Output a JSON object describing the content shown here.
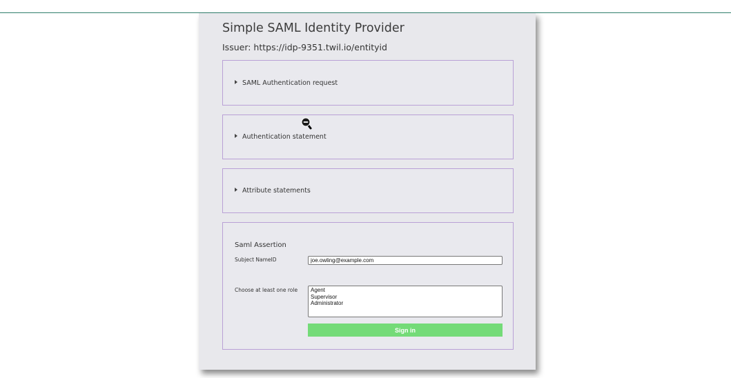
{
  "header": {
    "title": "Simple SAML Identity Provider",
    "issuer": "Issuer: https://idp-9351.twil.io/entityid"
  },
  "panels": [
    {
      "label": "SAML Authentication request"
    },
    {
      "label": "Authentication statement"
    },
    {
      "label": "Attribute statements"
    }
  ],
  "assertion": {
    "title": "Saml Assertion",
    "subject_label": "Subject NameID",
    "subject_value": "joe.owling@example.com",
    "roles_label": "Choose at least one role",
    "roles": [
      "Agent",
      "Supervisor",
      "Administrator"
    ],
    "signin_label": "Sign in"
  },
  "colors": {
    "accent_line": "#2f7d6b",
    "panel_border": "#b9a0d6",
    "signin_button": "#74db78"
  },
  "icons": {
    "cursor": "zoom-out-cursor-icon"
  }
}
